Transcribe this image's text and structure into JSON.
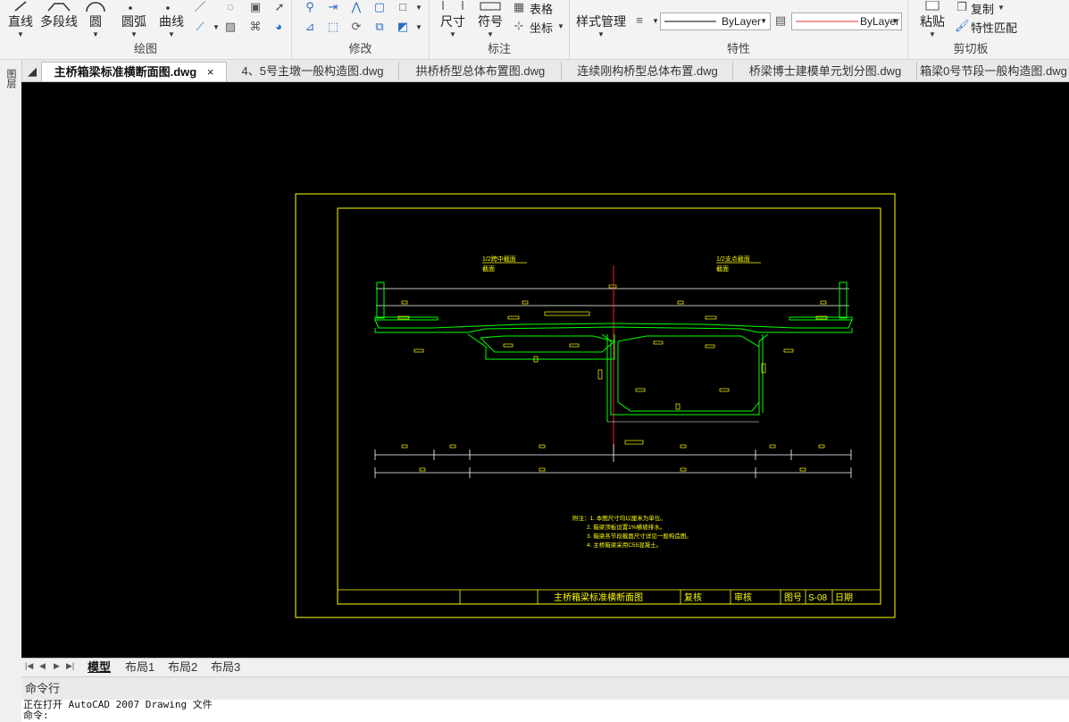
{
  "ribbon": {
    "draw_panel": {
      "title": "绘图",
      "buttons": [
        "直线",
        "多段线",
        "圆",
        "圆弧",
        "曲线"
      ]
    },
    "modify_panel": {
      "title": "修改"
    },
    "annotate_panel": {
      "title": "标注",
      "buttons": [
        "尺寸",
        "符号"
      ],
      "table_label": "表格",
      "coord_label": "坐标"
    },
    "properties_panel": {
      "title": "特性",
      "style_manager": "样式管理",
      "linetype_value": "ByLayer",
      "lineweight_value": "ByLayer"
    },
    "clipboard_panel": {
      "title": "剪切板",
      "paste": "粘贴",
      "copy": "复制",
      "match_props": "特性匹配"
    }
  },
  "tabs": [
    {
      "label": "主桥箱梁标准横断面图.dwg",
      "active": true,
      "closable": true
    },
    {
      "label": "4、5号主墩一般构造图.dwg"
    },
    {
      "label": "拱桥桥型总体布置图.dwg"
    },
    {
      "label": "连续刚构桥型总体布置.dwg"
    },
    {
      "label": "桥梁博士建模单元划分图.dwg"
    },
    {
      "label": "箱梁0号节段一般构造图.dwg"
    }
  ],
  "left_strip": {
    "label": "图层"
  },
  "drawing": {
    "left_label_1": "1/2跨中截面",
    "left_label_2": "截面",
    "right_label_1": "1/2支点截面",
    "right_label_2": "截面",
    "notes": [
      "附注：1. 本图尺寸均以厘米为单位。",
      "2. 箱梁顶板设置1%横坡排水。",
      "3. 箱梁各节段截面尺寸详见一般构造图。",
      "4. 主桥箱梁采用C55混凝土。"
    ],
    "title_block": {
      "title": "主桥箱梁标准横断面图",
      "review": "复核",
      "approve": "审核",
      "drawing_no_label": "图号",
      "drawing_no": "S-08",
      "date_label": "日期"
    },
    "colors": {
      "frame": "#ffff00",
      "structure": "#00ff00",
      "axis": "#ff0000",
      "dim": "#ffffff"
    }
  },
  "layout_tabs": [
    "模型",
    "布局1",
    "布局2",
    "布局3"
  ],
  "command": {
    "title": "命令行",
    "history": [
      "正在打开 AutoCAD 2007 Drawing 文件",
      "命令:"
    ]
  }
}
